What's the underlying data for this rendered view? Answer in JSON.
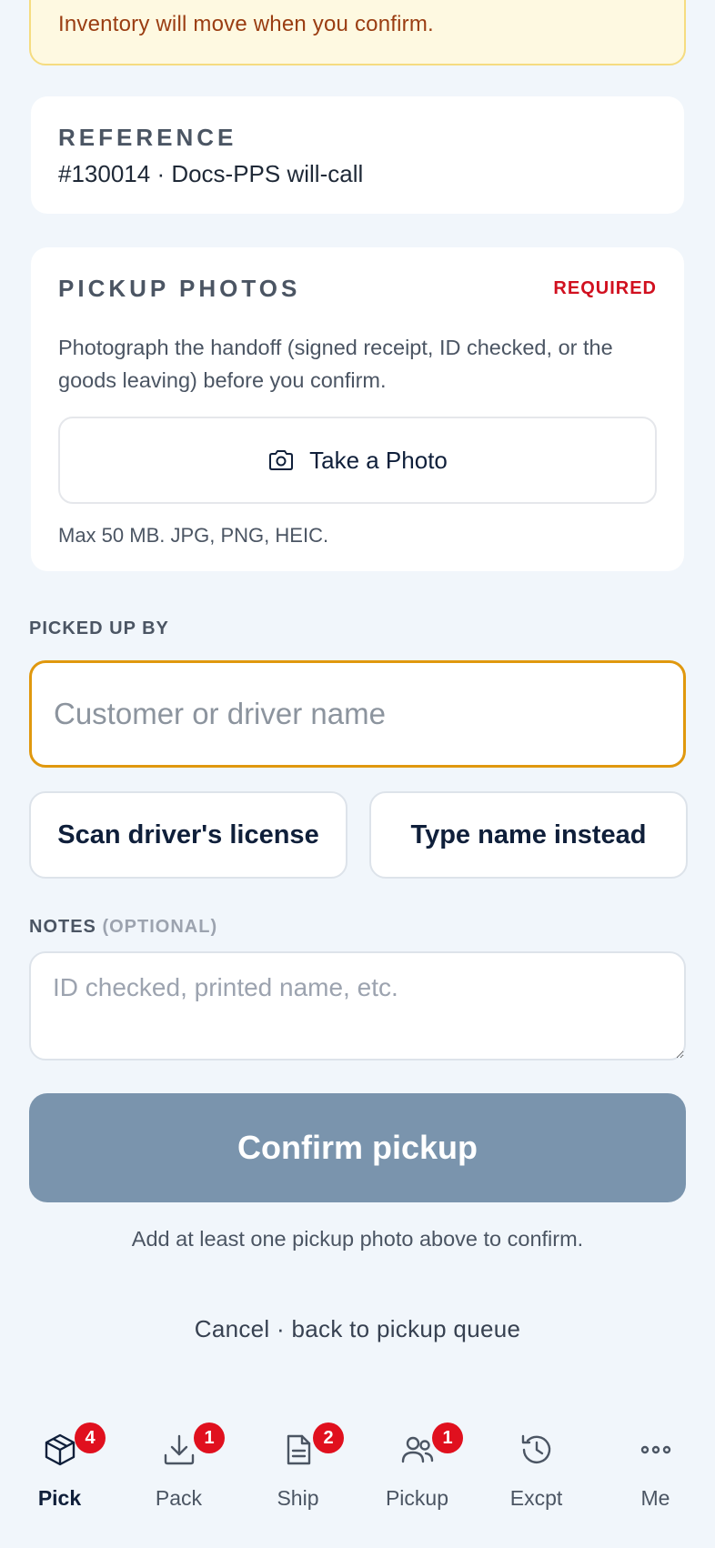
{
  "banner": {
    "text": "Inventory will move when you confirm."
  },
  "reference": {
    "title": "REFERENCE",
    "value": "#130014 · Docs-PPS will-call"
  },
  "pickup_photos": {
    "title": "PICKUP PHOTOS",
    "required_label": "REQUIRED",
    "description": "Photograph the handoff (signed receipt, ID checked, or the goods leaving) before you confirm.",
    "take_photo_label": "Take a Photo",
    "take_photo_icon": "camera-icon",
    "limits": "Max 50 MB. JPG, PNG, HEIC."
  },
  "picked_up_by": {
    "label": "PICKED UP BY",
    "value": "",
    "placeholder": "Customer or driver name",
    "scan_label": "Scan driver's license",
    "type_label": "Type name instead"
  },
  "notes": {
    "label": "NOTES",
    "optional": "(OPTIONAL)",
    "value": "",
    "placeholder": "ID checked, printed name, etc."
  },
  "confirm": {
    "label": "Confirm pickup",
    "enabled": false,
    "hint": "Add at least one pickup photo above to confirm."
  },
  "cancel": {
    "label": "Cancel · back to pickup queue"
  },
  "nav": {
    "items": [
      {
        "label": "Pick",
        "icon": "box-icon",
        "badge": "4",
        "active": true
      },
      {
        "label": "Pack",
        "icon": "download-icon",
        "badge": "1",
        "active": false
      },
      {
        "label": "Ship",
        "icon": "document-icon",
        "badge": "2",
        "active": false
      },
      {
        "label": "Pickup",
        "icon": "users-icon",
        "badge": "1",
        "active": false
      },
      {
        "label": "Excpt",
        "icon": "history-icon",
        "badge": "",
        "active": false
      },
      {
        "label": "Me",
        "icon": "more-icon",
        "badge": "",
        "active": false
      }
    ]
  },
  "colors": {
    "accent": "#e0980e",
    "badge": "#e0101e",
    "required": "#d1101f",
    "confirm_disabled": "#7a94ad",
    "banner_bg": "#fef9e1"
  }
}
